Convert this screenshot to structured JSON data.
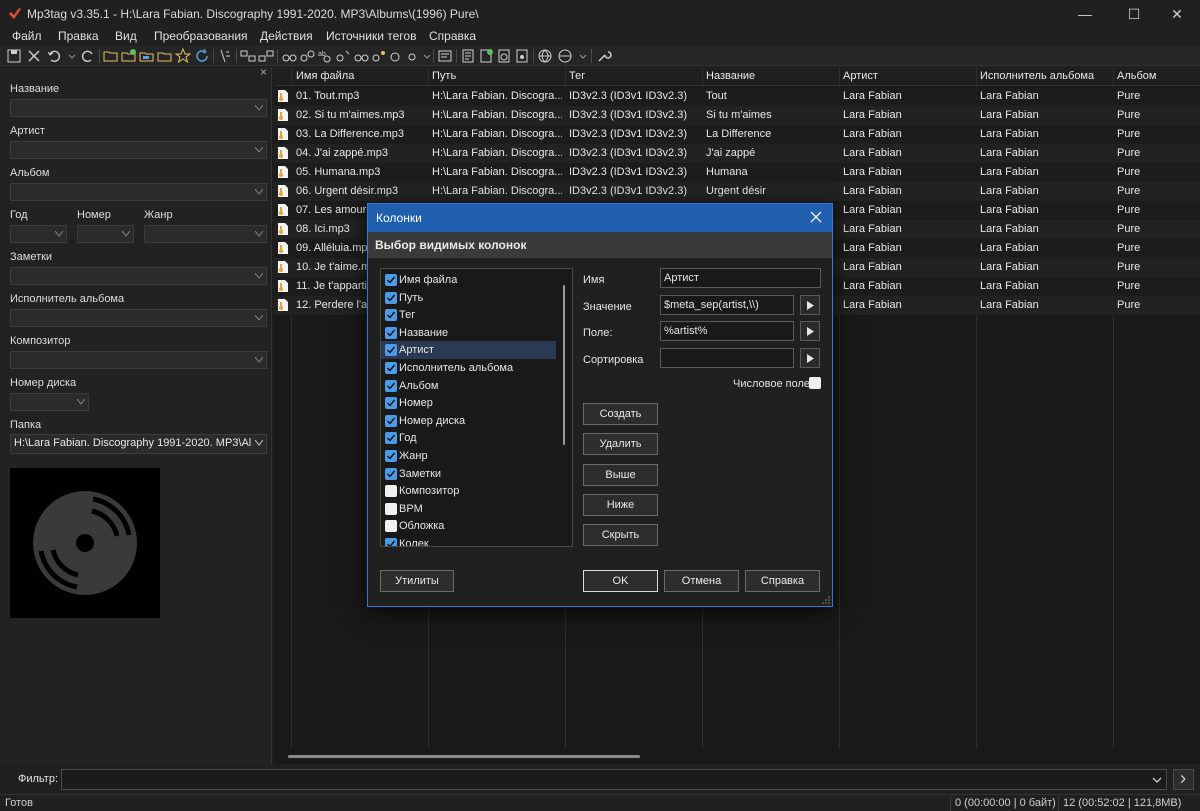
{
  "window": {
    "title": "Mp3tag v3.35.1  -  H:\\Lara Fabian. Discography 1991-2020. MP3\\Albums\\(1996) Pure\\",
    "minimize": "—",
    "maximize": "☐",
    "close": "✕"
  },
  "menu": [
    "Файл",
    "Правка",
    "Вид",
    "Преобразования",
    "Действия",
    "Источники тегов",
    "Справка"
  ],
  "left_panel": {
    "close": "×",
    "title_label": "Название",
    "artist_label": "Артист",
    "album_label": "Альбом",
    "year_label": "Год",
    "track_label": "Номер",
    "genre_label": "Жанр",
    "comment_label": "Заметки",
    "album_artist_label": "Исполнитель альбома",
    "composer_label": "Композитор",
    "disc_label": "Номер диска",
    "folder_label": "Папка",
    "folder_value": "H:\\Lara Fabian. Discography 1991-2020. MP3\\Albums\\(1996) Pure\\"
  },
  "grid": {
    "headers": [
      "Имя файла",
      "Путь",
      "Тег",
      "Название",
      "Артист",
      "Исполнитель альбома",
      "Альбом"
    ],
    "rows": [
      {
        "file": "01. Tout.mp3",
        "path": "H:\\Lara Fabian. Discogra...",
        "tag": "ID3v2.3 (ID3v1 ID3v2.3)",
        "title": "Tout",
        "artist": "Lara Fabian",
        "album_artist": "Lara Fabian",
        "album": "Pure"
      },
      {
        "file": "02. Si tu m'aimes.mp3",
        "path": "H:\\Lara Fabian. Discogra...",
        "tag": "ID3v2.3 (ID3v1 ID3v2.3)",
        "title": "Si tu m'aimes",
        "artist": "Lara Fabian",
        "album_artist": "Lara Fabian",
        "album": "Pure"
      },
      {
        "file": "03. La Difference.mp3",
        "path": "H:\\Lara Fabian. Discogra...",
        "tag": "ID3v2.3 (ID3v1 ID3v2.3)",
        "title": "La Difference",
        "artist": "Lara Fabian",
        "album_artist": "Lara Fabian",
        "album": "Pure"
      },
      {
        "file": "04. J'ai zappé.mp3",
        "path": "H:\\Lara Fabian. Discogra...",
        "tag": "ID3v2.3 (ID3v1 ID3v2.3)",
        "title": "J'ai zappé",
        "artist": "Lara Fabian",
        "album_artist": "Lara Fabian",
        "album": "Pure"
      },
      {
        "file": "05. Humana.mp3",
        "path": "H:\\Lara Fabian. Discogra...",
        "tag": "ID3v2.3 (ID3v1 ID3v2.3)",
        "title": "Humana",
        "artist": "Lara Fabian",
        "album_artist": "Lara Fabian",
        "album": "Pure"
      },
      {
        "file": "06. Urgent désir.mp3",
        "path": "H:\\Lara Fabian. Discogra...",
        "tag": "ID3v2.3 (ID3v1 ID3v2.3)",
        "title": "Urgent désir",
        "artist": "Lara Fabian",
        "album_artist": "Lara Fabian",
        "album": "Pure"
      },
      {
        "file": "07. Les amoure",
        "path": "",
        "tag": "",
        "title": "",
        "artist": "Lara Fabian",
        "album_artist": "Lara Fabian",
        "album": "Pure"
      },
      {
        "file": "08. Ici.mp3",
        "path": "",
        "tag": "",
        "title": "",
        "artist": "Lara Fabian",
        "album_artist": "Lara Fabian",
        "album": "Pure"
      },
      {
        "file": "09. Alléluia.mp",
        "path": "",
        "tag": "",
        "title": "",
        "artist": "Lara Fabian",
        "album_artist": "Lara Fabian",
        "album": "Pure"
      },
      {
        "file": "10. Je t'aime.m",
        "path": "",
        "tag": "",
        "title": "",
        "artist": "Lara Fabian",
        "album_artist": "Lara Fabian",
        "album": "Pure"
      },
      {
        "file": "11. Je t'apparti",
        "path": "",
        "tag": "",
        "title": "",
        "artist": "Lara Fabian",
        "album_artist": "Lara Fabian",
        "album": "Pure"
      },
      {
        "file": "12. Perdere l'ar",
        "path": "",
        "tag": "",
        "title": "",
        "artist": "Lara Fabian",
        "album_artist": "Lara Fabian",
        "album": "Pure"
      }
    ]
  },
  "filter": {
    "label": "Фильтр:",
    "value": ""
  },
  "status": {
    "ready": "Готов",
    "selected": "0 (00:00:00 | 0 байт)",
    "total": "12 (00:52:02 | 121,8MB)"
  },
  "dialog": {
    "title": "Колонки",
    "header": "Выбор видимых колонок",
    "columns": [
      {
        "label": "Имя файла",
        "checked": true
      },
      {
        "label": "Путь",
        "checked": true
      },
      {
        "label": "Тег",
        "checked": true
      },
      {
        "label": "Название",
        "checked": true
      },
      {
        "label": "Артист",
        "checked": true,
        "selected": true
      },
      {
        "label": "Исполнитель альбома",
        "checked": true
      },
      {
        "label": "Альбом",
        "checked": true
      },
      {
        "label": "Номер",
        "checked": true
      },
      {
        "label": "Номер диска",
        "checked": true
      },
      {
        "label": "Год",
        "checked": true
      },
      {
        "label": "Жанр",
        "checked": true
      },
      {
        "label": "Заметки",
        "checked": true
      },
      {
        "label": "Композитор",
        "checked": false
      },
      {
        "label": "BPM",
        "checked": false
      },
      {
        "label": "Обложка",
        "checked": false
      },
      {
        "label": "Колек",
        "checked": true
      }
    ],
    "name_label": "Имя",
    "name_value": "Артист",
    "value_label": "Значение",
    "value_value": "$meta_sep(artist,\\\\)",
    "field_label": "Поле:",
    "field_value": "%artist%",
    "sort_label": "Сортировка",
    "sort_value": "",
    "numeric_label": "Числовое поле",
    "buttons": {
      "create": "Создать",
      "delete": "Удалить",
      "up": "Выше",
      "down": "Ниже",
      "hide": "Скрыть",
      "utilities": "Утилиты",
      "ok": "OK",
      "cancel": "Отмена",
      "help": "Справка"
    }
  },
  "colors": {
    "accent": "#1f5fae",
    "checkbox": "#4c9be8",
    "file_icon": "#e8a33a"
  }
}
